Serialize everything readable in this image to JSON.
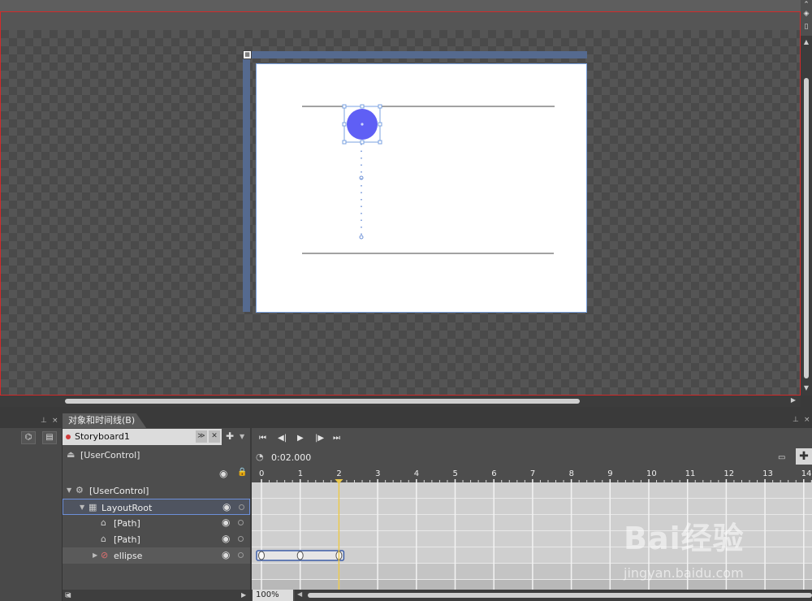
{
  "panel": {
    "tab_label": "对象和时间线(B)"
  },
  "storyboard": {
    "name": "Storyboard1"
  },
  "scope": {
    "label": "[UserControl]"
  },
  "tree": [
    {
      "label": "[UserControl]",
      "level": 0,
      "twisty": "▼"
    },
    {
      "label": "LayoutRoot",
      "level": 1,
      "twisty": "▼"
    },
    {
      "label": "[Path]",
      "level": 2,
      "twisty": ""
    },
    {
      "label": "[Path]",
      "level": 2,
      "twisty": ""
    },
    {
      "label": "ellipse",
      "level": 2,
      "twisty": "▶"
    }
  ],
  "timeline": {
    "current_time": "0:02.000",
    "playhead_seconds": 2,
    "ticks": [
      "0",
      "1",
      "2",
      "3",
      "4",
      "5",
      "6",
      "7",
      "8",
      "9",
      "10",
      "11",
      "12",
      "13",
      "14"
    ],
    "keyframes_seconds": [
      0,
      1,
      2
    ],
    "zoom": "100%"
  },
  "watermark": {
    "brand": "Bai经验",
    "url": "jingyan.baidu.com"
  },
  "colors": {
    "ellipse_fill": "#5f5ff5",
    "playhead": "#e8c64a",
    "record_frame": "#d22a2a"
  }
}
